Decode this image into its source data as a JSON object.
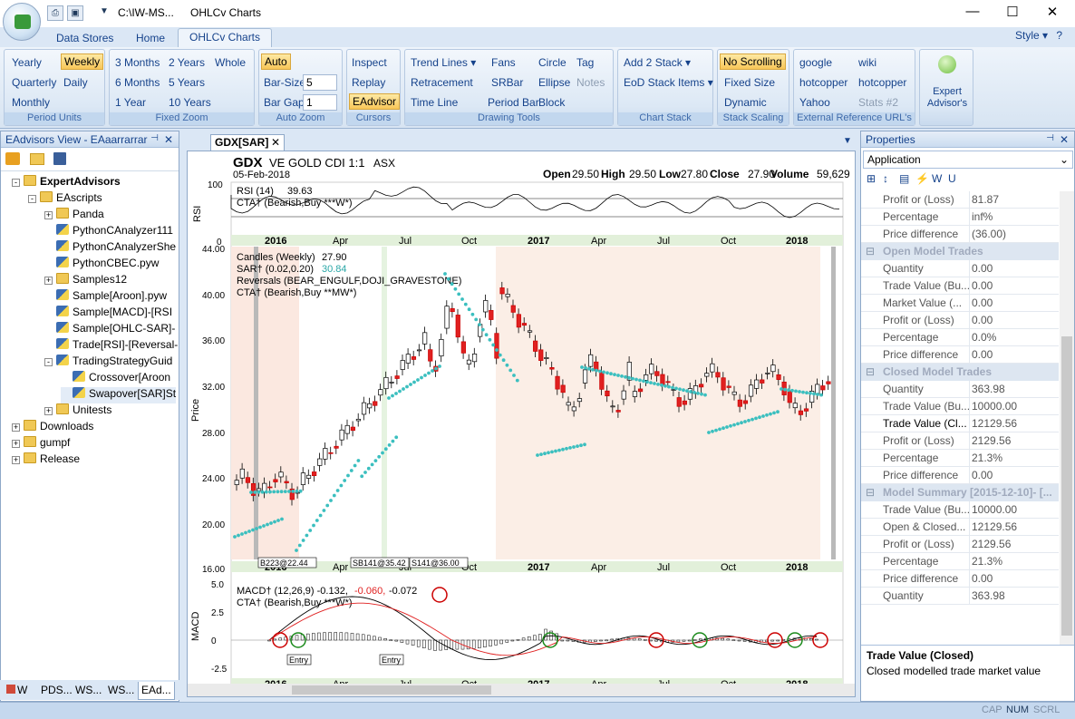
{
  "window": {
    "title_path": "C:\\IW-MS...",
    "title_app": "OHLCv Charts"
  },
  "tabs": [
    "Data Stores",
    "Home",
    "OHLCv Charts"
  ],
  "style_label": "Style",
  "ribbon": {
    "period": {
      "label": "Period Units",
      "items": [
        "Yearly",
        "Weekly",
        "Quarterly",
        "Daily",
        "Monthly"
      ],
      "selected": "Weekly"
    },
    "zoom": {
      "label": "Fixed Zoom",
      "items": [
        "3 Months",
        "2 Years",
        "Whole",
        "6 Months",
        "5 Years",
        "1 Year",
        "10 Years"
      ]
    },
    "autozoom": {
      "label": "Auto Zoom",
      "auto": "Auto",
      "barsize_label": "Bar-Size",
      "barsize": "5",
      "bargap_label": "Bar Gap",
      "bargap": "1"
    },
    "cursors": {
      "label": "Cursors",
      "items": [
        "Inspect",
        "Replay",
        "EAdvisor"
      ]
    },
    "drawing": {
      "label": "Drawing Tools",
      "items": [
        "Trend Lines",
        "Fans",
        "Circle",
        "Tag",
        "Retracement",
        "SRBar",
        "Ellipse",
        "Notes",
        "Time Line",
        "Period Bar",
        "Block"
      ]
    },
    "stack": {
      "label": "Chart Stack",
      "items": [
        "Add 2 Stack",
        "EoD Stack Items"
      ]
    },
    "scaling": {
      "label": "Stack Scaling",
      "items": [
        "No Scrolling",
        "Fixed Size",
        "Dynamic"
      ]
    },
    "ext": {
      "label": "External Reference URL's",
      "items": [
        "google",
        "wiki",
        "hotcopper",
        "hotcopper",
        "Yahoo",
        "Stats #2"
      ]
    },
    "advisor": {
      "label": "Expert Advisor's"
    }
  },
  "left_panel": {
    "title": "EAdvisors View - EAaarrarrar",
    "tree": [
      "ExpertAdvisors",
      "EAscripts",
      "Panda",
      "PythonCAnalyzer111",
      "PythonCAnalyzerShe",
      "PythonCBEC.pyw",
      "Samples12",
      "Sample[Aroon].pyw",
      "Sample[MACD]-[RSI",
      "Sample[OHLC-SAR]-",
      "Trade[RSI]-[Reversal-",
      "TradingStrategyGuid",
      "Crossover[Aroon",
      "Swapover[SAR]St",
      "Unitests",
      "Downloads",
      "gumpf",
      "Release"
    ],
    "bottom_tabs": [
      "W",
      "PDS...",
      "WS...",
      "WS...",
      "EAd..."
    ]
  },
  "doc_tab": "GDX[SAR]",
  "chart": {
    "symbol": "GDX",
    "name": "VE GOLD CDI 1:1",
    "exchange": "ASX",
    "date": "05-Feb-2018",
    "open_label": "Open",
    "open": "29.50",
    "high_label": "High",
    "high": "29.50",
    "low_label": "Low",
    "low": "27.80",
    "close_label": "Close",
    "close": "27.90",
    "volume_label": "Volume",
    "volume": "59,629",
    "rsi_axis": "RSI",
    "rsi_line1": "RSI (14)",
    "rsi_val": "39.63",
    "rsi_line2": "CTA† (Bearish,Buy  ***W*)",
    "price_axis": "Price",
    "candles": "Candles (Weekly)",
    "candles_val": "27.90",
    "sar": "SAR† (0.02,0.20)",
    "sar_val": "30.84",
    "reversals": "Reversals (BEAR_ENGULF,DOJI_GRAVESTONE)",
    "cta_price": "CTA† (Bearish,Buy  **MW*)",
    "macd_axis": "MACD",
    "macd": "MACD† (12,26,9) -0.132,",
    "macd_v2": "-0.060,",
    "macd_v3": "-0.072",
    "cta_macd": "CTA† (Bearish,Buy  ***W*)",
    "xticks": [
      "2016",
      "Apr",
      "Jul",
      "Oct",
      "2017",
      "Apr",
      "Jul",
      "Oct",
      "2018"
    ],
    "price_ticks": [
      "44.00",
      "40.00",
      "36.00",
      "32.00",
      "28.00",
      "24.00",
      "20.00",
      "16.00"
    ],
    "rsi_ticks": [
      "100",
      "0"
    ],
    "macd_ticks": [
      "5.0",
      "2.5",
      "0",
      "-2.5"
    ],
    "tags": [
      "B223@22.44",
      "SB141@35.42",
      "S141@36.00"
    ],
    "entry_label": "Entry"
  },
  "right_panel": {
    "title": "Properties",
    "combo": "Application",
    "rows": [
      {
        "k": "Profit or (Loss)",
        "v": "81.87"
      },
      {
        "k": "Percentage",
        "v": "inf%"
      },
      {
        "k": "Price difference",
        "v": "(36.00)"
      },
      {
        "sec": "Open Model Trades"
      },
      {
        "k": "Quantity",
        "v": "0.00"
      },
      {
        "k": "Trade Value (Bu...",
        "v": "0.00"
      },
      {
        "k": "Market Value (...",
        "v": "0.00"
      },
      {
        "k": "Profit or (Loss)",
        "v": "0.00"
      },
      {
        "k": "Percentage",
        "v": "0.0%"
      },
      {
        "k": "Price difference",
        "v": "0.00"
      },
      {
        "sec": "Closed Model Trades"
      },
      {
        "k": "Quantity",
        "v": "363.98"
      },
      {
        "k": "Trade Value (Bu...",
        "v": "10000.00"
      },
      {
        "k": "Trade Value (Cl...",
        "v": "12129.56"
      },
      {
        "k": "Profit or (Loss)",
        "v": "2129.56"
      },
      {
        "k": "Percentage",
        "v": "21.3%"
      },
      {
        "k": "Price difference",
        "v": "0.00"
      },
      {
        "sec": "Model Summary [2015-12-10]- [..."
      },
      {
        "k": "Trade Value (Bu...",
        "v": "10000.00"
      },
      {
        "k": "Open & Closed...",
        "v": "12129.56"
      },
      {
        "k": "Profit or (Loss)",
        "v": "2129.56"
      },
      {
        "k": "Percentage",
        "v": "21.3%"
      },
      {
        "k": "Price difference",
        "v": "0.00"
      },
      {
        "k": "Quantity",
        "v": "363.98"
      }
    ],
    "desc_title": "Trade Value (Closed)",
    "desc_text": "Closed modelled trade market value"
  },
  "status": [
    "CAP",
    "NUM",
    "SCRL"
  ]
}
